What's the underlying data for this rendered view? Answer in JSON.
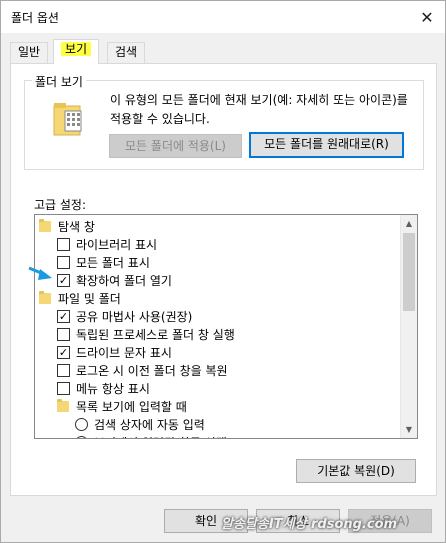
{
  "window": {
    "title": "폴더 옵션"
  },
  "tabs": [
    {
      "label": "일반"
    },
    {
      "label": "보기"
    },
    {
      "label": "검색"
    }
  ],
  "folder_view": {
    "group_title": "폴더 보기",
    "description": "이 유형의 모든 폴더에 현재 보기(예: 자세히 또는 아이콘)를 적용할 수 있습니다.",
    "apply_button": "모든 폴더에 적용(L)",
    "reset_button": "모든 폴더를 원래대로(R)"
  },
  "advanced": {
    "label": "고급 설정:",
    "items": [
      {
        "type": "folder",
        "label": "탐색 창",
        "level": 0
      },
      {
        "type": "checkbox",
        "label": "라이브러리 표시",
        "checked": false,
        "level": 1
      },
      {
        "type": "checkbox",
        "label": "모든 폴더 표시",
        "checked": false,
        "level": 1
      },
      {
        "type": "checkbox",
        "label": "확장하여 폴더 열기",
        "checked": true,
        "level": 1
      },
      {
        "type": "folder",
        "label": "파일 및 폴더",
        "level": 0
      },
      {
        "type": "checkbox",
        "label": "공유 마법사 사용(권장)",
        "checked": true,
        "level": 1
      },
      {
        "type": "checkbox",
        "label": "독립된 프로세스로 폴더 창 실행",
        "checked": false,
        "level": 1
      },
      {
        "type": "checkbox",
        "label": "드라이브 문자 표시",
        "checked": true,
        "level": 1
      },
      {
        "type": "checkbox",
        "label": "로그온 시 이전 폴더 창을 복원",
        "checked": false,
        "level": 1
      },
      {
        "type": "checkbox",
        "label": "메뉴 항상 표시",
        "checked": false,
        "level": 1
      },
      {
        "type": "folder",
        "label": "목록 보기에 입력할 때",
        "level": 1
      },
      {
        "type": "radio",
        "label": "검색 상자에 자동 입력",
        "checked": false,
        "level": 2
      },
      {
        "type": "radio",
        "label": "보기에서 입력된 항목 선택",
        "checked": false,
        "level": 2
      }
    ],
    "restore_defaults_button": "기본값 복원(D)"
  },
  "footer": {
    "ok": "확인",
    "cancel": "취소",
    "apply": "적용(A)"
  },
  "watermark": "알송달송IT세상 rdsong.com",
  "colors": {
    "accent": "#0078d7",
    "tab_highlight": "#ffff44",
    "folder": "#f6d776"
  }
}
